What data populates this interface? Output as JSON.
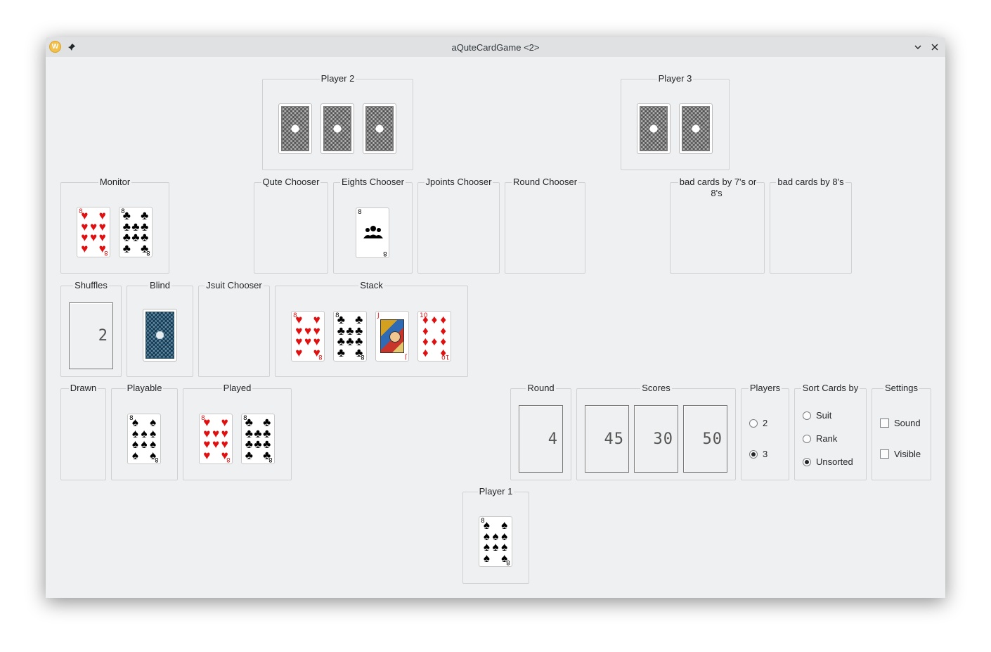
{
  "window": {
    "title": "aQuteCardGame <2>",
    "app_icon": "W"
  },
  "groups": {
    "player2": "Player 2",
    "player3": "Player 3",
    "monitor": "Monitor",
    "qute_chooser": "Qute Chooser",
    "eights_chooser": "Eights Chooser",
    "jpoints_chooser": "Jpoints Chooser",
    "round_chooser": "Round Chooser",
    "bad7or8": "bad cards by 7's or 8's",
    "bad8": "bad cards by 8's",
    "shuffles": "Shuffles",
    "blind": "Blind",
    "jsuit_chooser": "Jsuit Chooser",
    "stack": "Stack",
    "drawn": "Drawn",
    "playable": "Playable",
    "played": "Played",
    "round": "Round",
    "scores": "Scores",
    "players": "Players",
    "sort_cards_by": "Sort Cards by",
    "settings": "Settings",
    "player1": "Player 1"
  },
  "displays": {
    "shuffles": "2",
    "round": "4",
    "scores": [
      "45",
      "30",
      "50"
    ]
  },
  "players_options": [
    "2",
    "3"
  ],
  "players_selected": "3",
  "sort_options": [
    "Suit",
    "Rank",
    "Unsorted"
  ],
  "sort_selected": "Unsorted",
  "settings_options": [
    "Sound",
    "Visible"
  ],
  "cards": {
    "monitor": [
      {
        "rank": "8",
        "suit": "hearts"
      },
      {
        "rank": "8",
        "suit": "clubs"
      }
    ],
    "eights_chooser": [
      {
        "rank": "8",
        "suit": "people"
      }
    ],
    "stack": [
      {
        "rank": "8",
        "suit": "hearts"
      },
      {
        "rank": "8",
        "suit": "clubs"
      },
      {
        "rank": "J",
        "suit": "hearts"
      },
      {
        "rank": "10",
        "suit": "diamonds"
      }
    ],
    "playable": [
      {
        "rank": "8",
        "suit": "spades"
      }
    ],
    "played": [
      {
        "rank": "8",
        "suit": "hearts"
      },
      {
        "rank": "8",
        "suit": "clubs"
      }
    ],
    "player1": [
      {
        "rank": "8",
        "suit": "spades"
      }
    ]
  },
  "glyphs": {
    "hearts": "♥",
    "clubs": "♣",
    "spades": "♠",
    "diamonds": "♦"
  },
  "colors": {
    "window_bg": "#eff0f1",
    "red_suit": "#e01010",
    "black_suit": "#000000"
  }
}
